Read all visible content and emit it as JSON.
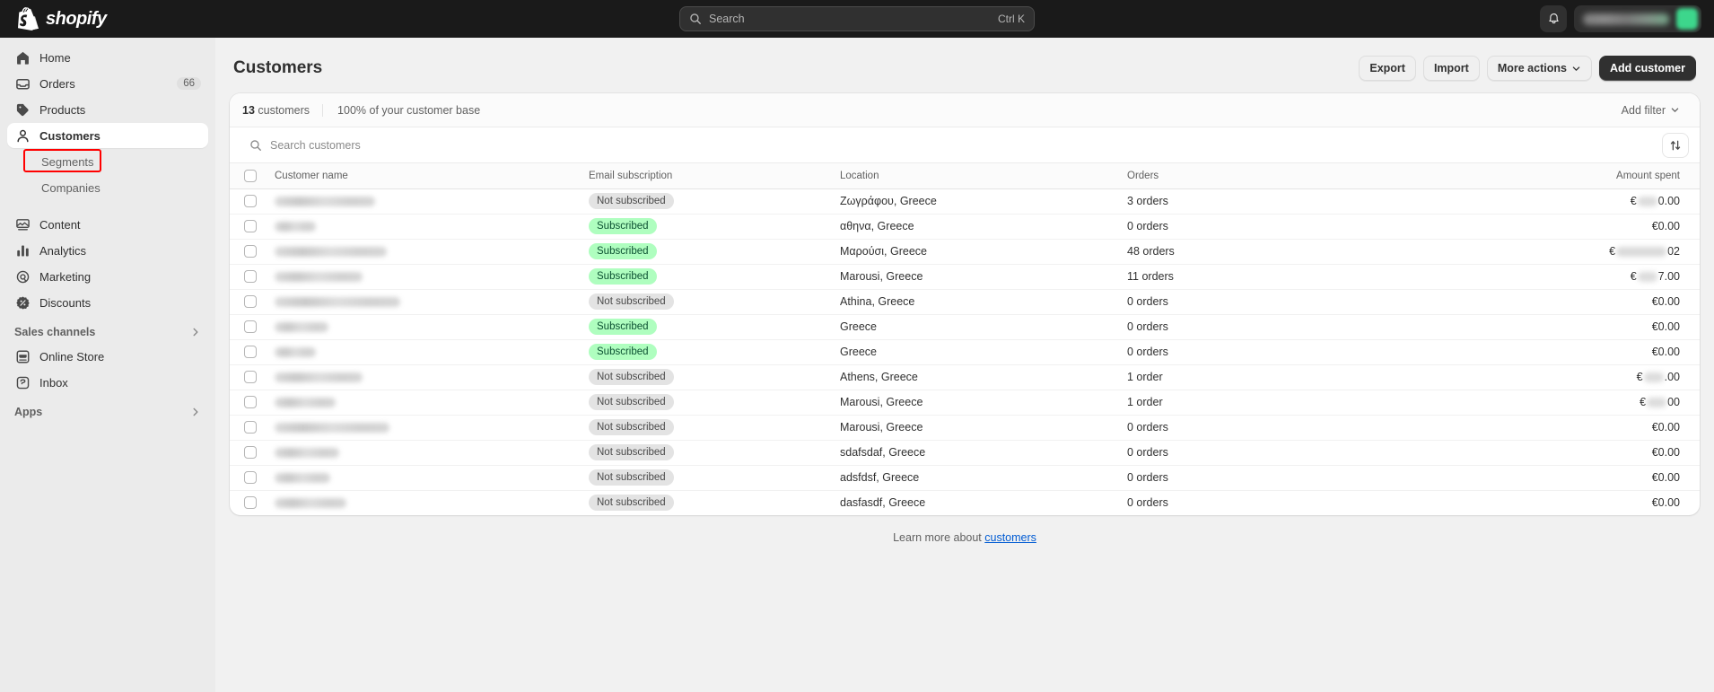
{
  "topbar": {
    "brand": "shopify",
    "search": {
      "placeholder": "Search",
      "shortcut": "Ctrl K",
      "icon": "search-icon"
    },
    "notifications_icon": "bell-icon",
    "account_name": "",
    "avatar_color": "#3dd68c"
  },
  "sidebar": {
    "items": [
      {
        "label": "Home",
        "icon": "home-icon",
        "badge": ""
      },
      {
        "label": "Orders",
        "icon": "orders-icon",
        "badge": "66"
      },
      {
        "label": "Products",
        "icon": "products-icon",
        "badge": ""
      },
      {
        "label": "Customers",
        "icon": "customers-icon",
        "badge": "",
        "active": true
      }
    ],
    "sub_items": [
      {
        "label": "Segments",
        "highlighted": true
      },
      {
        "label": "Companies",
        "highlighted": false
      }
    ],
    "items2": [
      {
        "label": "Content",
        "icon": "content-icon"
      },
      {
        "label": "Analytics",
        "icon": "analytics-icon"
      },
      {
        "label": "Marketing",
        "icon": "marketing-icon"
      },
      {
        "label": "Discounts",
        "icon": "discounts-icon"
      }
    ],
    "sales_channels": {
      "label": "Sales channels",
      "icon": "chevron-right-icon"
    },
    "channels": [
      {
        "label": "Online Store",
        "icon": "online-store-icon"
      },
      {
        "label": "Inbox",
        "icon": "inbox-icon"
      }
    ],
    "apps": {
      "label": "Apps",
      "icon": "chevron-right-icon"
    },
    "highlight_color": "#ff0000"
  },
  "page": {
    "title": "Customers",
    "actions": {
      "export": "Export",
      "import": "Import",
      "more_actions": "More actions",
      "add_customer": "Add customer"
    }
  },
  "filters": {
    "count_number": "13",
    "count_label": " customers",
    "base_label": "100% of your customer base",
    "add_filter": "Add filter"
  },
  "table_search": {
    "placeholder": "Search customers",
    "sort_icon": "sort-arrows-icon"
  },
  "table": {
    "columns": [
      "Customer name",
      "Email subscription",
      "Location",
      "Orders",
      "Amount spent"
    ],
    "rows": [
      {
        "name_width": 112,
        "note": false,
        "subscription": "Not subscribed",
        "subscribed": false,
        "location": "Ζωγράφου, Greece",
        "orders": "3 orders",
        "amount": "€0.00",
        "amount_blur": "small"
      },
      {
        "name_width": 46,
        "note": false,
        "subscription": "Subscribed",
        "subscribed": true,
        "location": "αθηνα, Greece",
        "orders": "0 orders",
        "amount": "€0.00",
        "amount_blur": "none"
      },
      {
        "name_width": 125,
        "note": true,
        "subscription": "Subscribed",
        "subscribed": true,
        "location": "Μαρούσι, Greece",
        "orders": "48 orders",
        "amount": "€02",
        "amount_blur": "medium"
      },
      {
        "name_width": 98,
        "note": false,
        "subscription": "Subscribed",
        "subscribed": true,
        "location": "Marousi, Greece",
        "orders": "11 orders",
        "amount": "€7.00",
        "amount_blur": "small"
      },
      {
        "name_width": 140,
        "note": false,
        "subscription": "Not subscribed",
        "subscribed": false,
        "location": "Athina, Greece",
        "orders": "0 orders",
        "amount": "€0.00",
        "amount_blur": "none"
      },
      {
        "name_width": 60,
        "note": false,
        "subscription": "Subscribed",
        "subscribed": true,
        "location": "Greece",
        "orders": "0 orders",
        "amount": "€0.00",
        "amount_blur": "none"
      },
      {
        "name_width": 46,
        "note": false,
        "subscription": "Subscribed",
        "subscribed": true,
        "location": "Greece",
        "orders": "0 orders",
        "amount": "€0.00",
        "amount_blur": "none"
      },
      {
        "name_width": 98,
        "note": true,
        "subscription": "Not subscribed",
        "subscribed": false,
        "location": "Athens, Greece",
        "orders": "1 order",
        "amount": "€.00",
        "amount_blur": "small"
      },
      {
        "name_width": 68,
        "note": true,
        "subscription": "Not subscribed",
        "subscribed": false,
        "location": "Marousi, Greece",
        "orders": "1 order",
        "amount": "€00",
        "amount_blur": "small"
      },
      {
        "name_width": 128,
        "note": false,
        "subscription": "Not subscribed",
        "subscribed": false,
        "location": "Marousi, Greece",
        "orders": "0 orders",
        "amount": "€0.00",
        "amount_blur": "none"
      },
      {
        "name_width": 72,
        "note": false,
        "subscription": "Not subscribed",
        "subscribed": false,
        "location": "sdafsdaf, Greece",
        "orders": "0 orders",
        "amount": "€0.00",
        "amount_blur": "none"
      },
      {
        "name_width": 62,
        "note": false,
        "subscription": "Not subscribed",
        "subscribed": false,
        "location": "adsfdsf, Greece",
        "orders": "0 orders",
        "amount": "€0.00",
        "amount_blur": "none"
      },
      {
        "name_width": 80,
        "note": false,
        "subscription": "Not subscribed",
        "subscribed": false,
        "location": "dasfasdf, Greece",
        "orders": "0 orders",
        "amount": "€0.00",
        "amount_blur": "none"
      }
    ]
  },
  "footer": {
    "text": "Learn more about ",
    "link": "customers"
  }
}
